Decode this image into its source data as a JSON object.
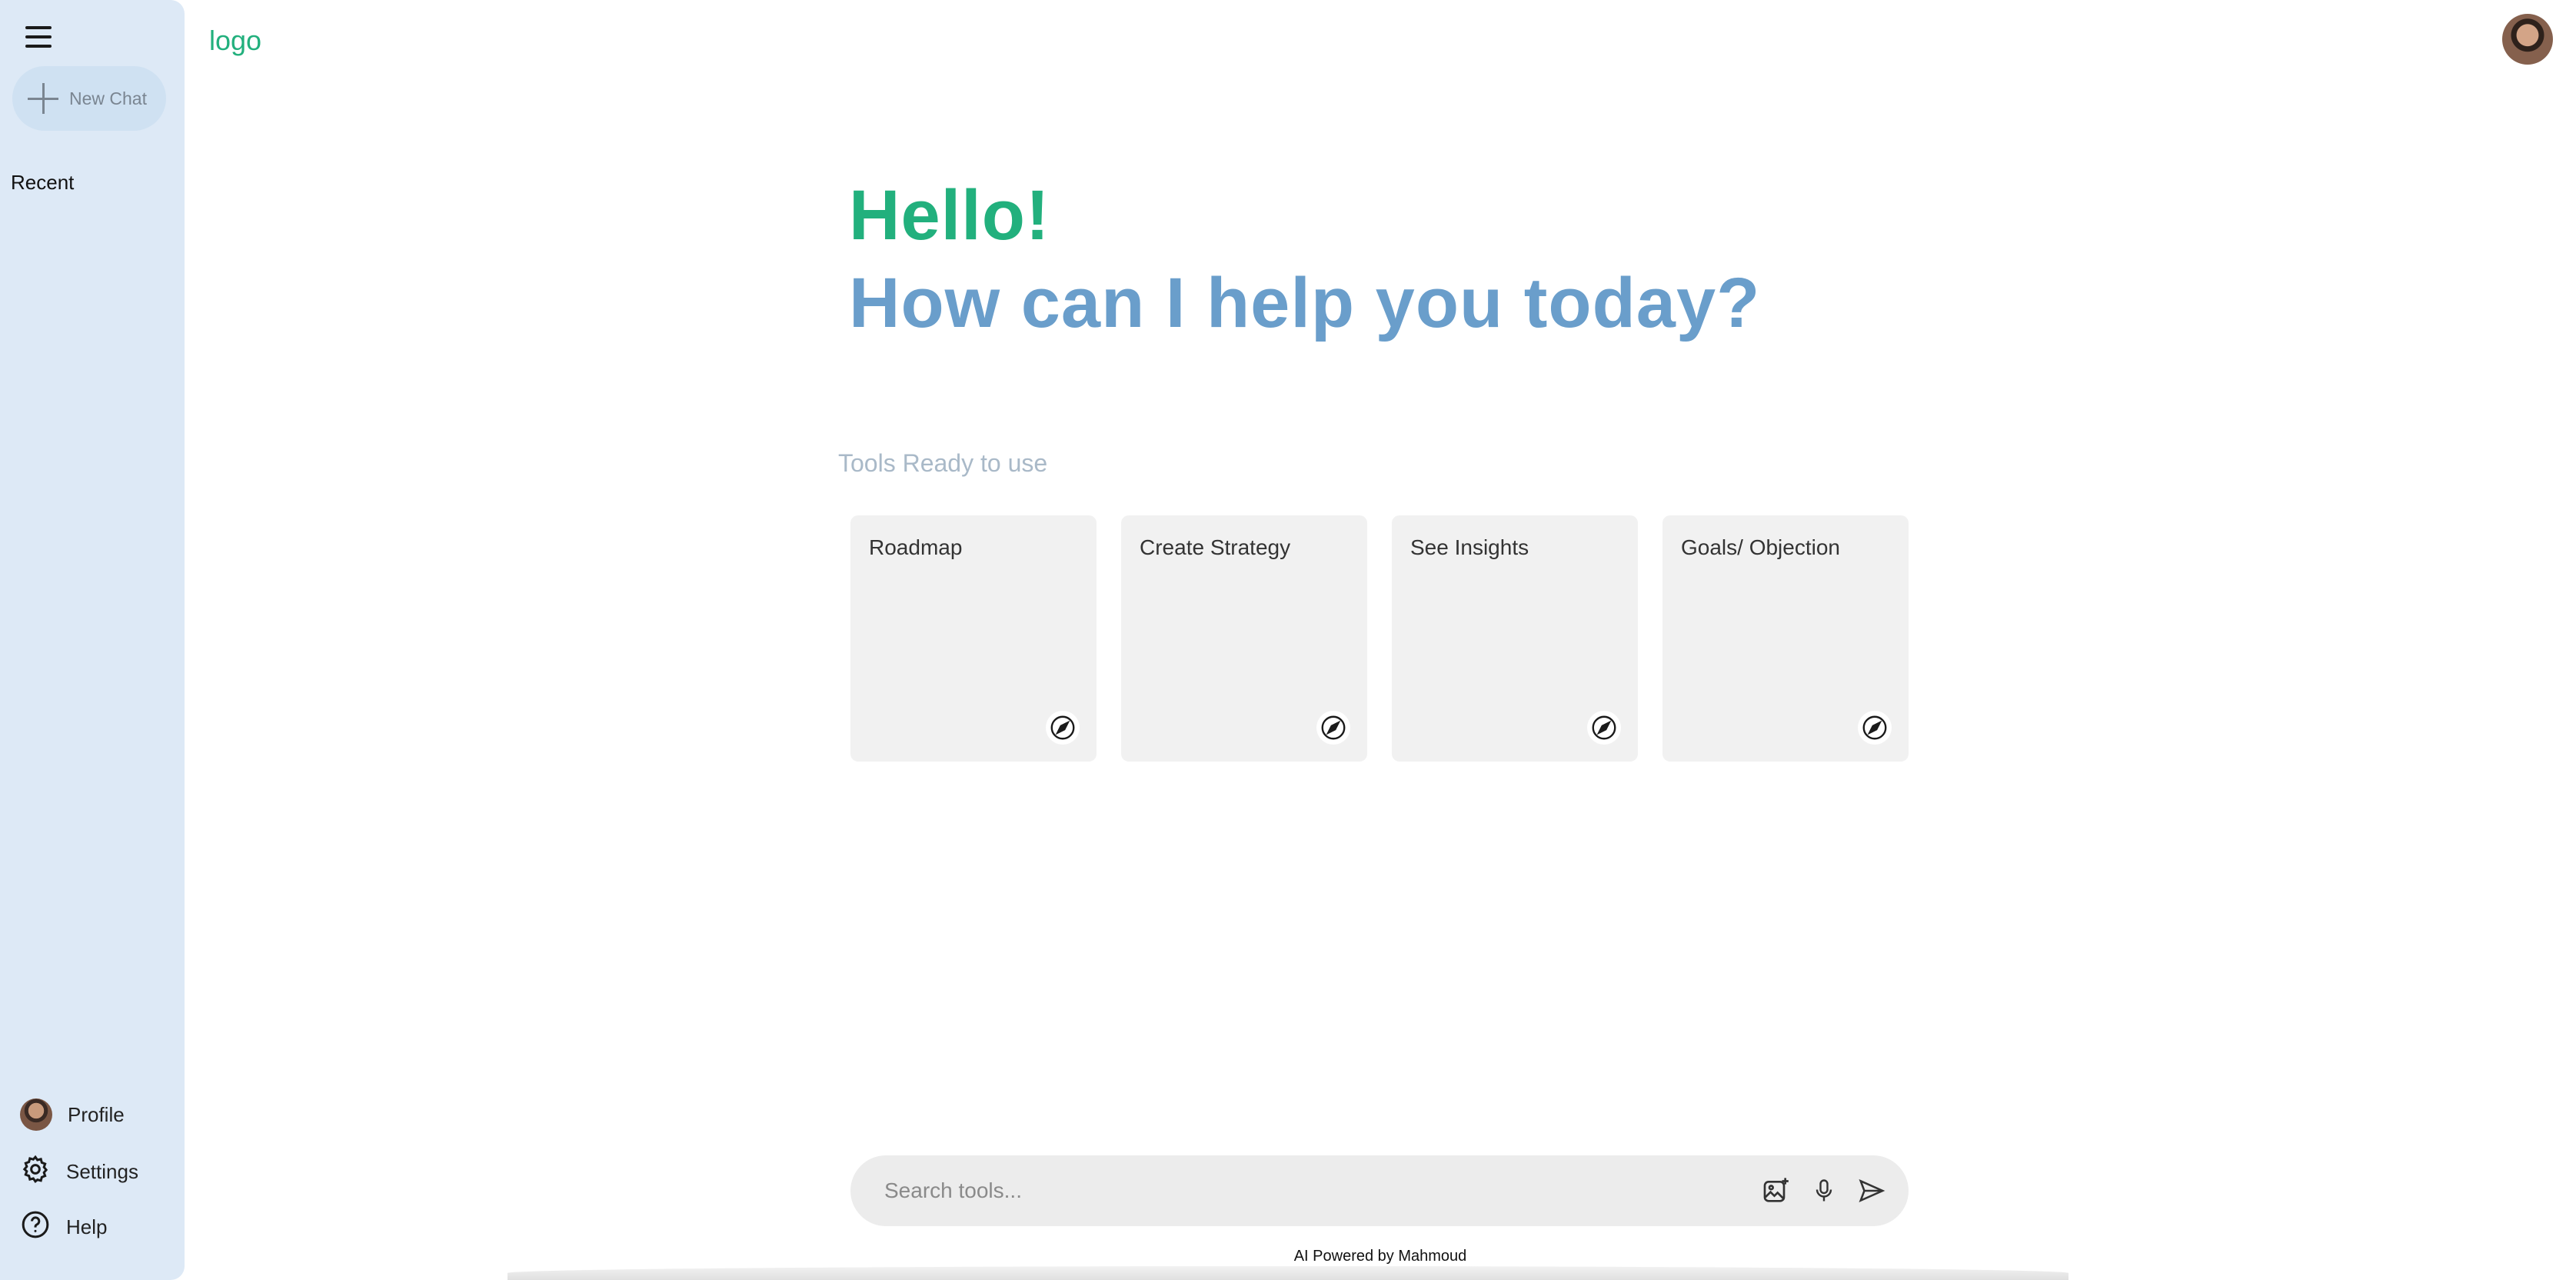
{
  "header": {
    "logo": "logo"
  },
  "sidebar": {
    "new_chat": "New Chat",
    "recent": "Recent",
    "bottom": {
      "profile": "Profile",
      "settings": "Settings",
      "help": "Help"
    }
  },
  "greeting": {
    "hello": "Hello!",
    "subtitle": "How can I help you today?"
  },
  "tools": {
    "label": "Tools Ready to use",
    "cards": [
      {
        "title": "Roadmap",
        "icon": "compass-icon"
      },
      {
        "title": "Create Strategy",
        "icon": "compass-icon"
      },
      {
        "title": "See Insights",
        "icon": "compass-icon"
      },
      {
        "title": "Goals/ Objection",
        "icon": "compass-icon"
      }
    ]
  },
  "search": {
    "placeholder": "Search tools...",
    "value": ""
  },
  "footer": {
    "powered_by": "AI Powered by Mahmoud"
  },
  "colors": {
    "accent_green": "#22b07d",
    "accent_blue": "#6a9ecb",
    "sidebar_bg": "#dde9f6"
  }
}
